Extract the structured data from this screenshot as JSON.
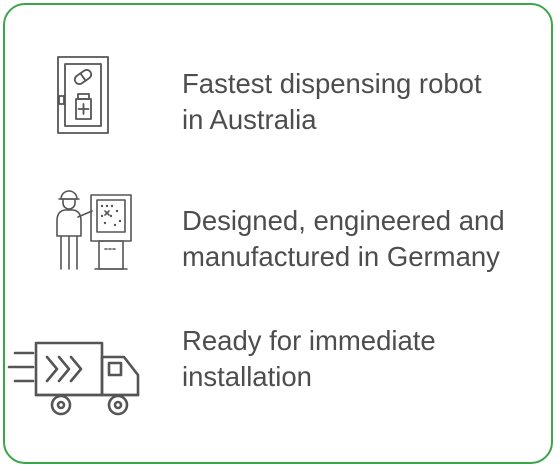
{
  "colors": {
    "card_border": "#3aa648",
    "text": "#4d4d4d",
    "icon_stroke": "#555555"
  },
  "features": [
    {
      "icon": "medicine-dispenser-icon",
      "line1": "Fastest dispensing robot",
      "line2": "in Australia"
    },
    {
      "icon": "engineer-at-machine-icon",
      "line1": "Designed, engineered and",
      "line2": "manufactured in Germany"
    },
    {
      "icon": "fast-delivery-truck-icon",
      "line1": "Ready for immediate",
      "line2": "installation"
    }
  ]
}
